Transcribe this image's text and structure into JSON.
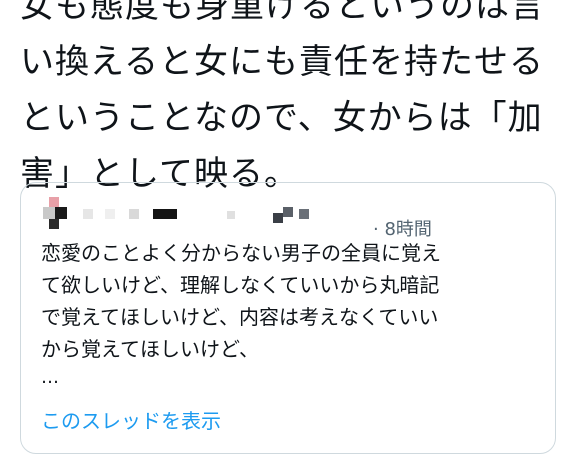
{
  "tweet": {
    "lines": [
      "女も態度も身重けるというのは言",
      "い換えると女にも責任を持たせる",
      "ということなので、女からは「加",
      "害」として映る。"
    ]
  },
  "quote": {
    "time": "· 8時間",
    "lines": [
      "恋愛のことよく分からない男子の全員に覚え",
      "て欲しいけど、理解しなくていいから丸暗記",
      "で覚えてほしいけど、内容は考えなくていい",
      "から覚えてほしいけど、"
    ],
    "ellipsis": "…",
    "show_thread": "このスレッドを表示"
  },
  "colors": {
    "link": "#1d9bf0",
    "muted": "#536471",
    "border": "#cfd9de"
  }
}
